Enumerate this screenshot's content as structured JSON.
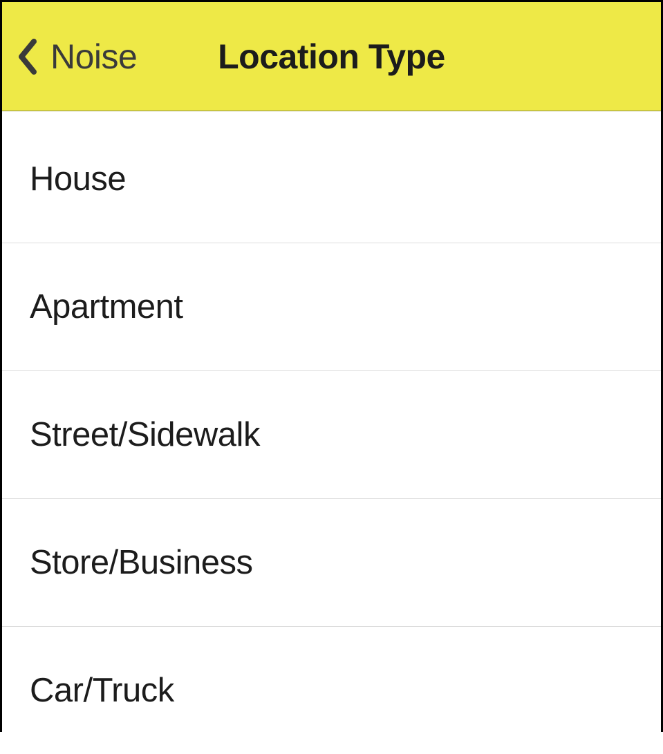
{
  "header": {
    "back_label": "Noise",
    "title": "Location Type"
  },
  "options": [
    {
      "label": "House"
    },
    {
      "label": "Apartment"
    },
    {
      "label": "Street/Sidewalk"
    },
    {
      "label": "Store/Business"
    },
    {
      "label": "Car/Truck"
    }
  ]
}
